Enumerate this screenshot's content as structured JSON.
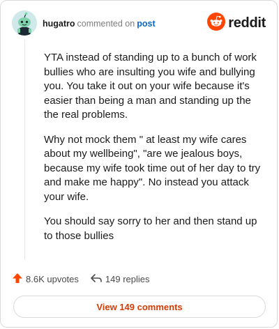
{
  "header": {
    "username": "hugatro",
    "action": "commented on",
    "post_link": "post",
    "logo_text": "reddit"
  },
  "comment": {
    "paragraphs": [
      "YTA instead of standing up to a bunch of work bullies who are insulting you wife and bullying you. You take it out on your wife because it's easier than being a man and standing up the the real problems.",
      "Why not mock them \" at least my wife cares about my wellbeing\", \"are we jealous boys, because my wife took time out of her day to try and make me happy\". No instead you attack your wife.",
      "You should say sorry to her and then stand up to those bullies"
    ]
  },
  "footer": {
    "upvotes": "8.6K upvotes",
    "replies": "149 replies",
    "view_comments": "View 149 comments"
  },
  "colors": {
    "accent": "#d93a00",
    "link": "#0a66c2",
    "reddit_orange": "#ff4500"
  },
  "icons": {
    "avatar": "snoo-avatar-icon",
    "logo": "reddit-logo-icon",
    "upvote": "upvote-arrow-icon",
    "reply": "reply-arrow-icon"
  }
}
